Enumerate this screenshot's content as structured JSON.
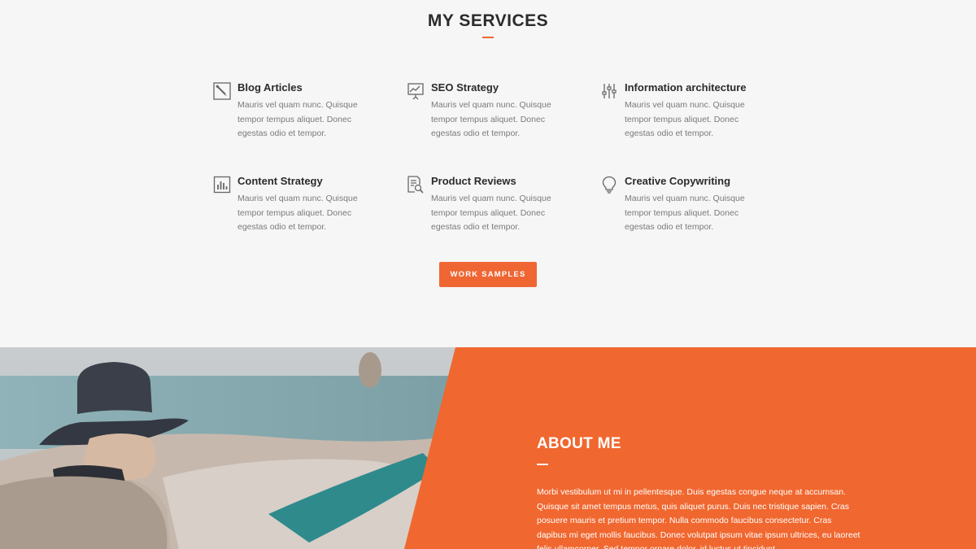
{
  "services": {
    "title": "MY SERVICES",
    "items": [
      {
        "title": "Blog Articles",
        "icon": "edit-icon",
        "text": "Mauris vel quam nunc. Quisque tempor tempus aliquet. Donec egestas odio et tempor."
      },
      {
        "title": "SEO Strategy",
        "icon": "presentation-chart-icon",
        "text": "Mauris vel quam nunc. Quisque tempor tempus aliquet. Donec egestas odio et tempor."
      },
      {
        "title": "Information architecture",
        "icon": "sliders-icon",
        "text": "Mauris vel quam nunc. Quisque tempor tempus aliquet. Donec egestas odio et tempor."
      },
      {
        "title": "Content Strategy",
        "icon": "bar-chart-icon",
        "text": "Mauris vel quam nunc. Quisque tempor tempus aliquet. Donec egestas odio et tempor."
      },
      {
        "title": "Product Reviews",
        "icon": "document-search-icon",
        "text": "Mauris vel quam nunc. Quisque tempor tempus aliquet. Donec egestas odio et tempor."
      },
      {
        "title": "Creative Copywriting",
        "icon": "lightbulb-icon",
        "text": "Mauris vel quam nunc. Quisque tempor tempus aliquet. Donec egestas odio et tempor."
      }
    ],
    "button_label": "WORK SAMPLES"
  },
  "about": {
    "title": "ABOUT ME",
    "text": "Morbi vestibulum ut mi in pellentesque. Duis egestas congue neque at accumsan. Quisque sit amet tempus metus, quis aliquet purus. Duis nec tristique sapien. Cras posuere mauris et pretium tempor. Nulla commodo faucibus consectetur. Cras dapibus mi eget mollis faucibus. Donec volutpat ipsum vitae ipsum ultrices, eu laoreet felis ullamcorper. Sed tempor ornare dolor, id luctus ut tincidunt."
  },
  "colors": {
    "accent": "#ef6633",
    "background": "#f6f6f6",
    "heading": "#2b2b2b",
    "body_text": "#7a7a7a"
  }
}
